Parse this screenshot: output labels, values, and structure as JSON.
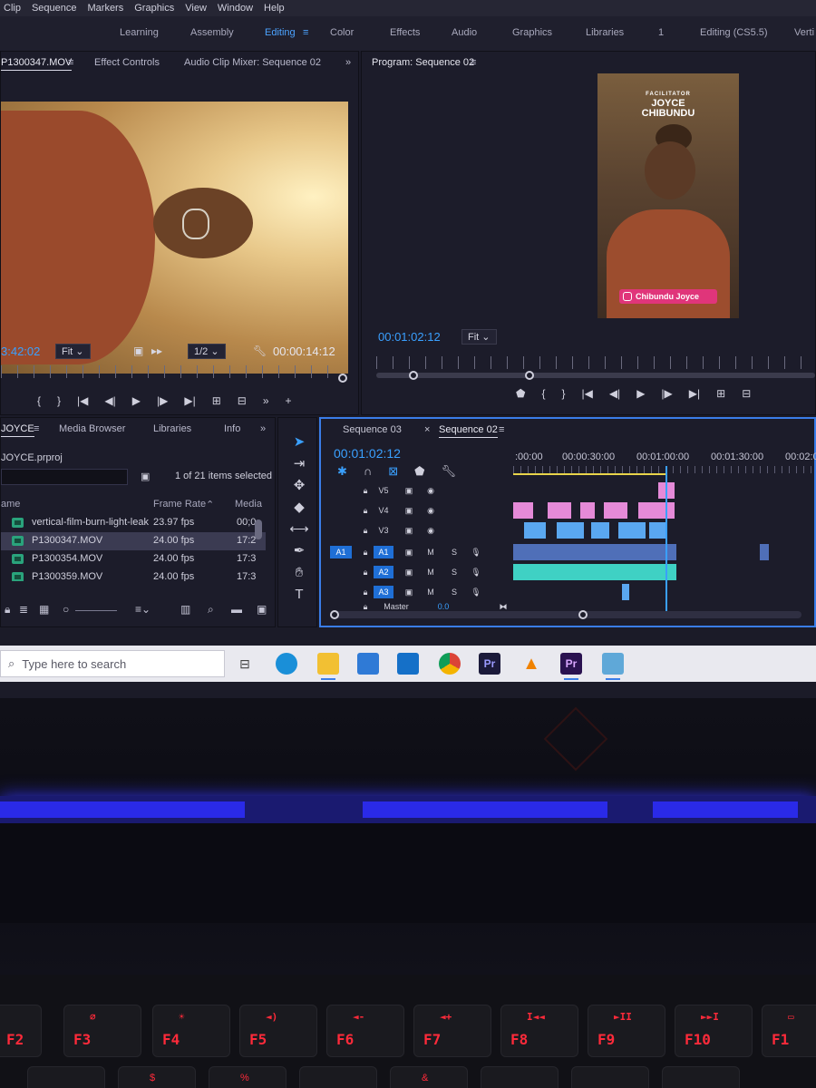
{
  "menu": [
    "Clip",
    "Sequence",
    "Markers",
    "Graphics",
    "View",
    "Window",
    "Help"
  ],
  "workspaces": {
    "items": [
      "Learning",
      "Assembly",
      "Editing",
      "Color",
      "Effects",
      "Audio",
      "Graphics",
      "Libraries"
    ],
    "active": "Editing",
    "menu_icon": "≡",
    "count": "1",
    "right_label": "Editing (CS5.5)",
    "overflow_label": "Verti"
  },
  "source_monitor": {
    "tabs": [
      "P1300347.MOV",
      "Effect Controls",
      "Audio Clip Mixer: Sequence 02"
    ],
    "menu_icon": "≡",
    "overflow": "»",
    "timecode_left": "3:42:02",
    "fit": "Fit",
    "resolution": "1/2",
    "duration": "00:00:14:12"
  },
  "program_monitor": {
    "title": "Program: Sequence 02",
    "menu_icon": "≡",
    "timecode": "00:01:02:12",
    "fit": "Fit",
    "video": {
      "tag": "FACILITATOR",
      "name_line1": "JOYCE",
      "name_line2": "CHIBUNDU",
      "lower_third": "Chibundu Joyce"
    }
  },
  "project_panel": {
    "tabs": [
      "JOYCE",
      "Media Browser",
      "Libraries",
      "Info"
    ],
    "menu_icon": "≡",
    "overflow": "»",
    "project_file": "JOYCE.prproj",
    "selection_status": "1 of 21 items selected",
    "columns": [
      "ame",
      "Frame Rate",
      "Media"
    ],
    "rows": [
      {
        "name": "vertical-film-burn-light-leak",
        "fps": "23.97 fps",
        "media": "00;0"
      },
      {
        "name": "P1300347.MOV",
        "fps": "24.00 fps",
        "media": "17:2",
        "selected": true
      },
      {
        "name": "P1300354.MOV",
        "fps": "24.00 fps",
        "media": "17:3"
      },
      {
        "name": "P1300359.MOV",
        "fps": "24.00 fps",
        "media": "17:3"
      }
    ]
  },
  "timeline": {
    "tabs": [
      "Sequence 03",
      "Sequence 02"
    ],
    "active_tab": "Sequence 02",
    "close_icon": "×",
    "menu_icon": "≡",
    "timecode": "00:01:02:12",
    "ruler_labels": [
      ":00:00",
      "00:00:30:00",
      "00:01:00:00",
      "00:01:30:00",
      "00:02:0"
    ],
    "video_tracks": [
      "V5",
      "V4",
      "V3"
    ],
    "audio_tracks": [
      "A1",
      "A2",
      "A3"
    ],
    "source_patch": "A1",
    "mute_label": "M",
    "solo_label": "S",
    "master_label": "Master",
    "master_value": "0.0"
  },
  "taskbar": {
    "search_placeholder": "Type here to search",
    "apps": [
      "task-view",
      "edge",
      "file-explorer",
      "store",
      "mail",
      "chrome",
      "premiere-rush",
      "vlc",
      "premiere-pro",
      "photos"
    ],
    "premiere_label": "Pr"
  },
  "keyboard": {
    "keys": [
      {
        "label": "F2",
        "icon": ""
      },
      {
        "label": "F3",
        "icon": "⌀"
      },
      {
        "label": "F4",
        "icon": "☀"
      },
      {
        "label": "F5",
        "icon": "◄)"
      },
      {
        "label": "F6",
        "icon": "◄-"
      },
      {
        "label": "F7",
        "icon": "◄+"
      },
      {
        "label": "F8",
        "icon": "I◄◄"
      },
      {
        "label": "F9",
        "icon": "►II"
      },
      {
        "label": "F10",
        "icon": "►►I"
      },
      {
        "label": "F1",
        "icon": "▭"
      }
    ]
  },
  "colors": {
    "accent": "#3aa0ff",
    "video_clip_pink": "#e58ad8",
    "video_clip_blue": "#5aa7f0",
    "audio_clip_cyan": "#3fd1c4",
    "audio_clip_blue": "#4f6fb8",
    "keyboard_backlight": "#ff2a3a"
  }
}
